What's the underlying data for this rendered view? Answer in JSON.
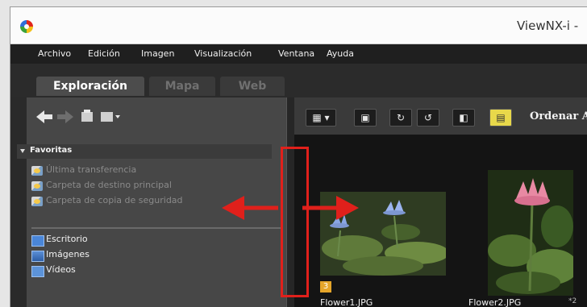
{
  "window": {
    "title": "ViewNX-i -"
  },
  "menubar": {
    "items": [
      "Archivo",
      "Edición",
      "Imagen",
      "Visualización",
      "Ventana",
      "Ayuda"
    ]
  },
  "tabs": [
    {
      "label": "Exploración",
      "active": true
    },
    {
      "label": "Mapa",
      "active": false
    },
    {
      "label": "Web",
      "active": false
    }
  ],
  "left_pane": {
    "favorites_title": "Favoritas",
    "favorites": [
      "Última transferencia",
      "Carpeta de destino principal",
      "Carpeta de copia de seguridad"
    ],
    "libraries": [
      "Escritorio",
      "Imágenes",
      "Vídeos"
    ]
  },
  "toolbar": {
    "sort_label": "Ordenar A"
  },
  "thumbnails": [
    {
      "name": "Flower1.JPG",
      "badge": "3"
    },
    {
      "name": "Flower2.JPG",
      "extra": "*2"
    }
  ],
  "colors": {
    "annotation": "#e0201b",
    "badge": "#e5a52a"
  }
}
